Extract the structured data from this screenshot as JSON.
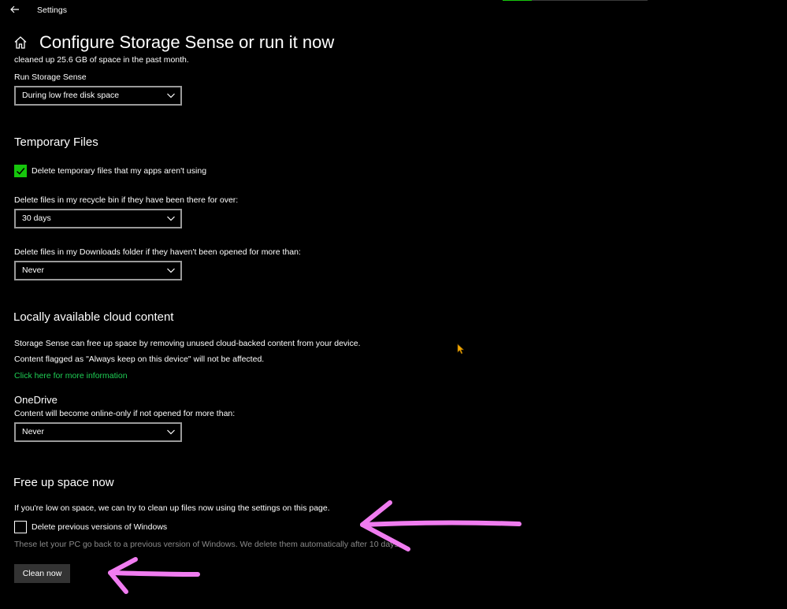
{
  "window": {
    "app_title": "Settings",
    "progress_fraction": 0.2
  },
  "header": {
    "title": "Configure Storage Sense or run it now"
  },
  "storage_sense": {
    "clipped_text": "cleaned up 25.6 GB of space in the past month.",
    "run_label": "Run Storage Sense",
    "run_value": "During low free disk space"
  },
  "temporary_files": {
    "heading": "Temporary Files",
    "delete_temp_label": "Delete temporary files that my apps aren't using",
    "delete_temp_checked": true,
    "recycle_label": "Delete files in my recycle bin if they have been there for over:",
    "recycle_value": "30 days",
    "downloads_label": "Delete files in my Downloads folder if they haven't been opened for more than:",
    "downloads_value": "Never"
  },
  "cloud": {
    "heading": "Locally available cloud content",
    "line1": "Storage Sense can free up space by removing unused cloud-backed content from your device.",
    "line2": "Content flagged as \"Always keep on this device\" will not be affected.",
    "link": "Click here for more information",
    "onedrive_heading": "OneDrive",
    "onedrive_label": "Content will become online-only if not opened for more than:",
    "onedrive_value": "Never"
  },
  "free_up": {
    "heading": "Free up space now",
    "intro": "If you're low on space, we can try to clean up files now using the settings on this page.",
    "delete_windows_label": "Delete previous versions of Windows",
    "delete_windows_checked": false,
    "delete_windows_note": "These let your PC go back to a previous version of Windows. We delete them automatically after 10 days.",
    "clean_button": "Clean now"
  },
  "colors": {
    "accent": "#16c60c",
    "link": "#1fcf55",
    "annotation": "#f07cf0",
    "background": "#000000"
  },
  "icons": [
    "back-arrow-icon",
    "home-icon",
    "chevron-down-icon",
    "checkmark-icon",
    "mouse-cursor-icon"
  ]
}
